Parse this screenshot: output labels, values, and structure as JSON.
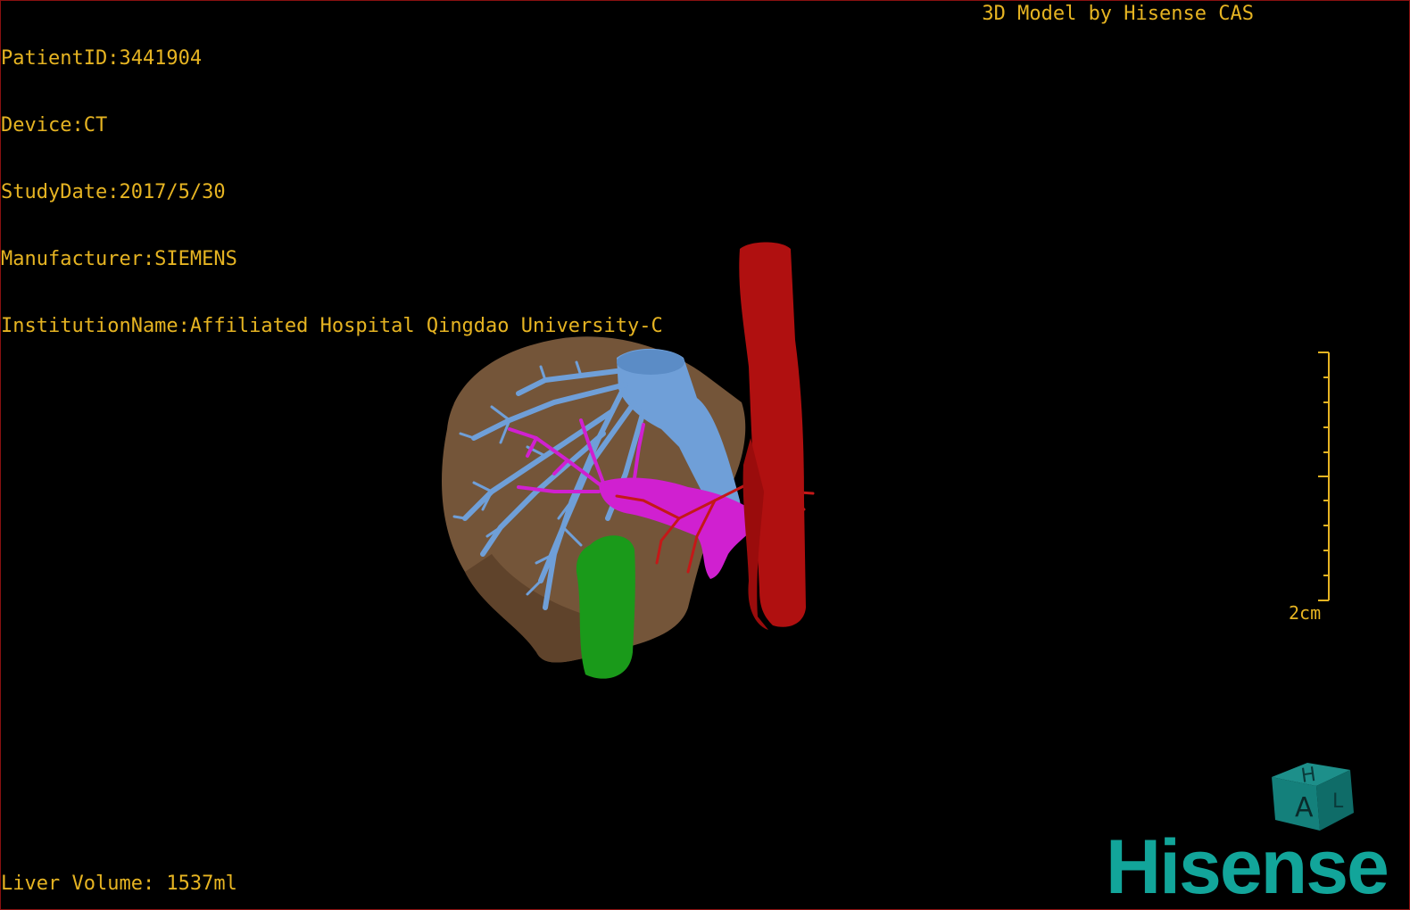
{
  "header": {
    "patient_id": "PatientID:3441904",
    "device": "Device:CT",
    "study_date": "StudyDate:2017/5/30",
    "manufacturer": "Manufacturer:SIEMENS",
    "institution": "InstitutionName:Affiliated Hospital Qingdao University-C",
    "model_credit": "3D Model by Hisense CAS"
  },
  "footer": {
    "liver_volume": "Liver Volume: 1537ml"
  },
  "scale_bar": {
    "label": "2cm"
  },
  "orientation_cube": {
    "front_label": "A",
    "top_label": "H",
    "side_label": "L"
  },
  "brand": {
    "name": "Hisense",
    "color": "#12a59a"
  },
  "colors": {
    "overlay_text": "#e6b422",
    "liver": "#7a5a3c",
    "hepatic_vein": "#6f9fd8",
    "portal_vein": "#d020d0",
    "artery": "#c41818",
    "aorta": "#b01010",
    "gallbladder": "#1a9a1a",
    "border": "#8a1010"
  }
}
